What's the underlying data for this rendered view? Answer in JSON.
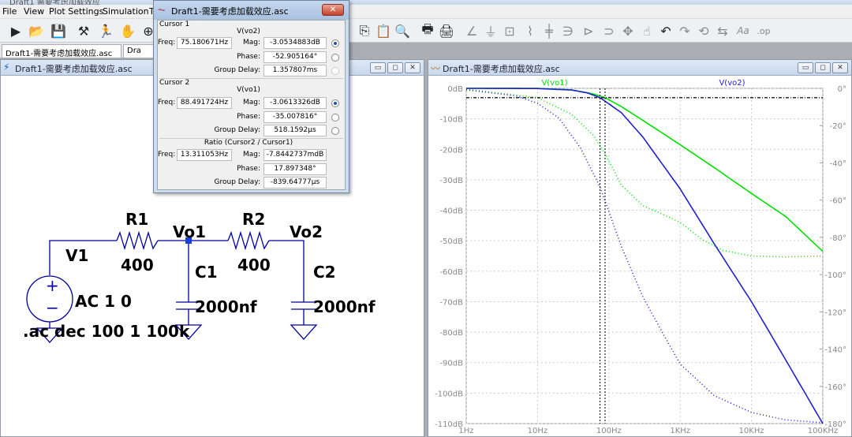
{
  "app": {
    "title_fragment": "Draft1 需要考虑加载效应"
  },
  "menu": [
    "File",
    "View",
    "Plot Settings",
    "Simulation",
    "T"
  ],
  "tabs": [
    {
      "label": "Draft1-需要考虑加载效应.asc"
    },
    {
      "label": "Dra"
    }
  ],
  "schematic_window": {
    "title": "Draft1-需要考虑加载效应.asc"
  },
  "plot_window": {
    "title": "Draft1-需要考虑加载效应.asc"
  },
  "cursor_dialog": {
    "title": "Draft1-需要考虑加载效应.asc",
    "close": "✕",
    "cursor1": {
      "group": "Cursor 1",
      "trace": "V(vo2)",
      "freq_label": "Freq:",
      "freq": "75.180671Hz",
      "mag_label": "Mag:",
      "mag": "-3.0534883dB",
      "phase_label": "Phase:",
      "phase": "-52.905164°",
      "gd_label": "Group Delay:",
      "gd": "1.357807ms"
    },
    "cursor2": {
      "group": "Cursor 2",
      "trace": "V(vo1)",
      "freq_label": "Freq:",
      "freq": "88.491724Hz",
      "mag_label": "Mag:",
      "mag": "-3.0613326dB",
      "phase_label": "Phase:",
      "phase": "-35.007816°",
      "gd_label": "Group Delay:",
      "gd": "518.1592µs"
    },
    "ratio": {
      "group": "Ratio (Cursor2 / Cursor1)",
      "freq_label": "Freq:",
      "freq": "13.311053Hz",
      "mag_label": "Mag:",
      "mag": "-7.8442737mdB",
      "phase_label": "Phase:",
      "phase": "17.897348°",
      "gd_label": "Group Delay:",
      "gd": "-839.64777µs"
    }
  },
  "schematic": {
    "r1": "R1",
    "r1_val": "400",
    "r2": "R2",
    "r2_val": "400",
    "vo1": "Vo1",
    "vo2": "Vo2",
    "v1": "V1",
    "v1_val": "AC 1 0",
    "c1": "C1",
    "c1_val": "2000nf",
    "c2": "C2",
    "c2_val": "2000nf",
    "directive": ".ac dec 100 1 100k"
  },
  "chart_data": {
    "type": "line",
    "x_scale": "log",
    "xlim": [
      1,
      100000
    ],
    "x_ticks": [
      "1Hz",
      "10Hz",
      "100Hz",
      "1KHz",
      "10KHz",
      "100KHz"
    ],
    "y_left_ticks": [
      "0dB",
      "-10dB",
      "-20dB",
      "-30dB",
      "-40dB",
      "-50dB",
      "-60dB",
      "-70dB",
      "-80dB",
      "-90dB",
      "-100dB",
      "-110dB"
    ],
    "ylim_left": [
      -110,
      0
    ],
    "y_right_ticks": [
      "0°",
      "-20°",
      "-40°",
      "-60°",
      "-80°",
      "-100°",
      "-120°",
      "-140°",
      "-160°",
      "-180°"
    ],
    "ylim_right": [
      -180,
      0
    ],
    "series": [
      {
        "name": "V(vo1)",
        "color": "#00e000",
        "mag": [
          [
            1,
            0
          ],
          [
            10,
            -0.03
          ],
          [
            30,
            -0.5
          ],
          [
            60,
            -1.8
          ],
          [
            88.5,
            -3.06
          ],
          [
            150,
            -6
          ],
          [
            300,
            -10.5
          ],
          [
            1000,
            -18.5
          ],
          [
            3000,
            -26
          ],
          [
            10000,
            -34.5
          ],
          [
            30000,
            -42
          ],
          [
            100000,
            -53.5
          ]
        ],
        "phase": [
          [
            1,
            -0.5
          ],
          [
            10,
            -5
          ],
          [
            30,
            -14
          ],
          [
            60,
            -25
          ],
          [
            88.5,
            -35
          ],
          [
            150,
            -52
          ],
          [
            300,
            -63
          ],
          [
            600,
            -68
          ],
          [
            1000,
            -72
          ],
          [
            2000,
            -81
          ],
          [
            4000,
            -87
          ],
          [
            10000,
            -90
          ],
          [
            30000,
            -90.5
          ],
          [
            100000,
            -90
          ]
        ]
      },
      {
        "name": "V(vo2)",
        "color": "#2020d0",
        "mag": [
          [
            1,
            0
          ],
          [
            10,
            -0.05
          ],
          [
            30,
            -0.55
          ],
          [
            50,
            -1.5
          ],
          [
            75.2,
            -3.05
          ],
          [
            150,
            -8
          ],
          [
            300,
            -16
          ],
          [
            1000,
            -33
          ],
          [
            3000,
            -51
          ],
          [
            10000,
            -70
          ],
          [
            30000,
            -89
          ],
          [
            100000,
            -110
          ]
        ],
        "phase": [
          [
            1,
            -0.8
          ],
          [
            5,
            -4
          ],
          [
            10,
            -8
          ],
          [
            20,
            -16
          ],
          [
            40,
            -32
          ],
          [
            75.2,
            -52.9
          ],
          [
            150,
            -85
          ],
          [
            300,
            -112
          ],
          [
            600,
            -133
          ],
          [
            1000,
            -148
          ],
          [
            3000,
            -165
          ],
          [
            10000,
            -174
          ],
          [
            30000,
            -178
          ],
          [
            100000,
            -179.5
          ]
        ]
      }
    ],
    "cursors": [
      {
        "freq": 75.180671,
        "mag": -3.0534883
      },
      {
        "freq": 88.491724,
        "mag": -3.0613326
      }
    ]
  }
}
